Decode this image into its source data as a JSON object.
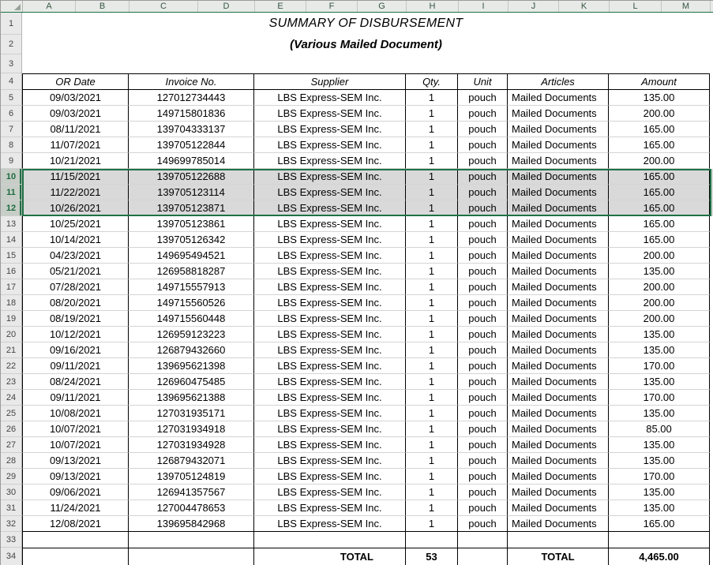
{
  "sheet": {
    "title": "SUMMARY OF DISBURSEMENT",
    "subtitle": "(Various Mailed Document)",
    "column_letters": [
      "A",
      "B",
      "C",
      "D",
      "E",
      "F",
      "G",
      "H",
      "I",
      "J",
      "K",
      "L",
      "M"
    ],
    "row_numbers": [
      1,
      2,
      3,
      4,
      5,
      6,
      7,
      8,
      9,
      10,
      11,
      12,
      13,
      14,
      15,
      16,
      17,
      18,
      19,
      20,
      21,
      22,
      23,
      24,
      25,
      26,
      27,
      28,
      29,
      30,
      31,
      32,
      33,
      34
    ],
    "selected_row_numbers": [
      10,
      11,
      12
    ]
  },
  "table": {
    "headers": [
      "OR Date",
      "Invoice No.",
      "Supplier",
      "Qty.",
      "Unit",
      "Articles",
      "Amount"
    ],
    "rows": [
      [
        "09/03/2021",
        "127012734443",
        "LBS Express-SEM Inc.",
        "1",
        "pouch",
        "Mailed Documents",
        "135.00"
      ],
      [
        "09/03/2021",
        "149715801836",
        "LBS Express-SEM Inc.",
        "1",
        "pouch",
        "Mailed Documents",
        "200.00"
      ],
      [
        "08/11/2021",
        "139704333137",
        "LBS Express-SEM Inc.",
        "1",
        "pouch",
        "Mailed Documents",
        "165.00"
      ],
      [
        "11/07/2021",
        "139705122844",
        "LBS Express-SEM Inc.",
        "1",
        "pouch",
        "Mailed Documents",
        "165.00"
      ],
      [
        "10/21/2021",
        "149699785014",
        "LBS Express-SEM Inc.",
        "1",
        "pouch",
        "Mailed Documents",
        "200.00"
      ],
      [
        "11/15/2021",
        "139705122688",
        "LBS Express-SEM Inc.",
        "1",
        "pouch",
        "Mailed Documents",
        "165.00"
      ],
      [
        "11/22/2021",
        "139705123114",
        "LBS Express-SEM Inc.",
        "1",
        "pouch",
        "Mailed Documents",
        "165.00"
      ],
      [
        "10/26/2021",
        "139705123871",
        "LBS Express-SEM Inc.",
        "1",
        "pouch",
        "Mailed Documents",
        "165.00"
      ],
      [
        "10/25/2021",
        "139705123861",
        "LBS Express-SEM Inc.",
        "1",
        "pouch",
        "Mailed Documents",
        "165.00"
      ],
      [
        "10/14/2021",
        "139705126342",
        "LBS Express-SEM Inc.",
        "1",
        "pouch",
        "Mailed Documents",
        "165.00"
      ],
      [
        "04/23/2021",
        "149695494521",
        "LBS Express-SEM Inc.",
        "1",
        "pouch",
        "Mailed Documents",
        "200.00"
      ],
      [
        "05/21/2021",
        "126958818287",
        "LBS Express-SEM Inc.",
        "1",
        "pouch",
        "Mailed Documents",
        "135.00"
      ],
      [
        "07/28/2021",
        "149715557913",
        "LBS Express-SEM Inc.",
        "1",
        "pouch",
        "Mailed Documents",
        "200.00"
      ],
      [
        "08/20/2021",
        "149715560526",
        "LBS Express-SEM Inc.",
        "1",
        "pouch",
        "Mailed Documents",
        "200.00"
      ],
      [
        "08/19/2021",
        "149715560448",
        "LBS Express-SEM Inc.",
        "1",
        "pouch",
        "Mailed Documents",
        "200.00"
      ],
      [
        "10/12/2021",
        "126959123223",
        "LBS Express-SEM Inc.",
        "1",
        "pouch",
        "Mailed Documents",
        "135.00"
      ],
      [
        "09/16/2021",
        "126879432660",
        "LBS Express-SEM Inc.",
        "1",
        "pouch",
        "Mailed Documents",
        "135.00"
      ],
      [
        "09/11/2021",
        "139695621398",
        "LBS Express-SEM Inc.",
        "1",
        "pouch",
        "Mailed Documents",
        "170.00"
      ],
      [
        "08/24/2021",
        "126960475485",
        "LBS Express-SEM Inc.",
        "1",
        "pouch",
        "Mailed Documents",
        "135.00"
      ],
      [
        "09/11/2021",
        "139695621388",
        "LBS Express-SEM Inc.",
        "1",
        "pouch",
        "Mailed Documents",
        "170.00"
      ],
      [
        "10/08/2021",
        "127031935171",
        "LBS Express-SEM Inc.",
        "1",
        "pouch",
        "Mailed Documents",
        "135.00"
      ],
      [
        "10/07/2021",
        "127031934918",
        "LBS Express-SEM Inc.",
        "1",
        "pouch",
        "Mailed Documents",
        "85.00"
      ],
      [
        "10/07/2021",
        "127031934928",
        "LBS Express-SEM Inc.",
        "1",
        "pouch",
        "Mailed Documents",
        "135.00"
      ],
      [
        "09/13/2021",
        "126879432071",
        "LBS Express-SEM Inc.",
        "1",
        "pouch",
        "Mailed Documents",
        "135.00"
      ],
      [
        "09/13/2021",
        "139705124819",
        "LBS Express-SEM Inc.",
        "1",
        "pouch",
        "Mailed Documents",
        "170.00"
      ],
      [
        "09/06/2021",
        "126941357567",
        "LBS Express-SEM Inc.",
        "1",
        "pouch",
        "Mailed Documents",
        "135.00"
      ],
      [
        "11/24/2021",
        "127004478653",
        "LBS Express-SEM Inc.",
        "1",
        "pouch",
        "Mailed Documents",
        "135.00"
      ],
      [
        "12/08/2021",
        "139695842968",
        "LBS Express-SEM Inc.",
        "1",
        "pouch",
        "Mailed Documents",
        "165.00"
      ]
    ],
    "totals": {
      "label_supplier": "TOTAL",
      "qty": "53",
      "label_articles": "TOTAL",
      "amount": "4,465.00"
    }
  },
  "colors": {
    "selection_border": "#1e7145",
    "selection_fill": "#d9d9d9",
    "grid_line": "#d4d4d4",
    "cell_border": "#000000",
    "header_strip_bg": "#e7eae7"
  }
}
